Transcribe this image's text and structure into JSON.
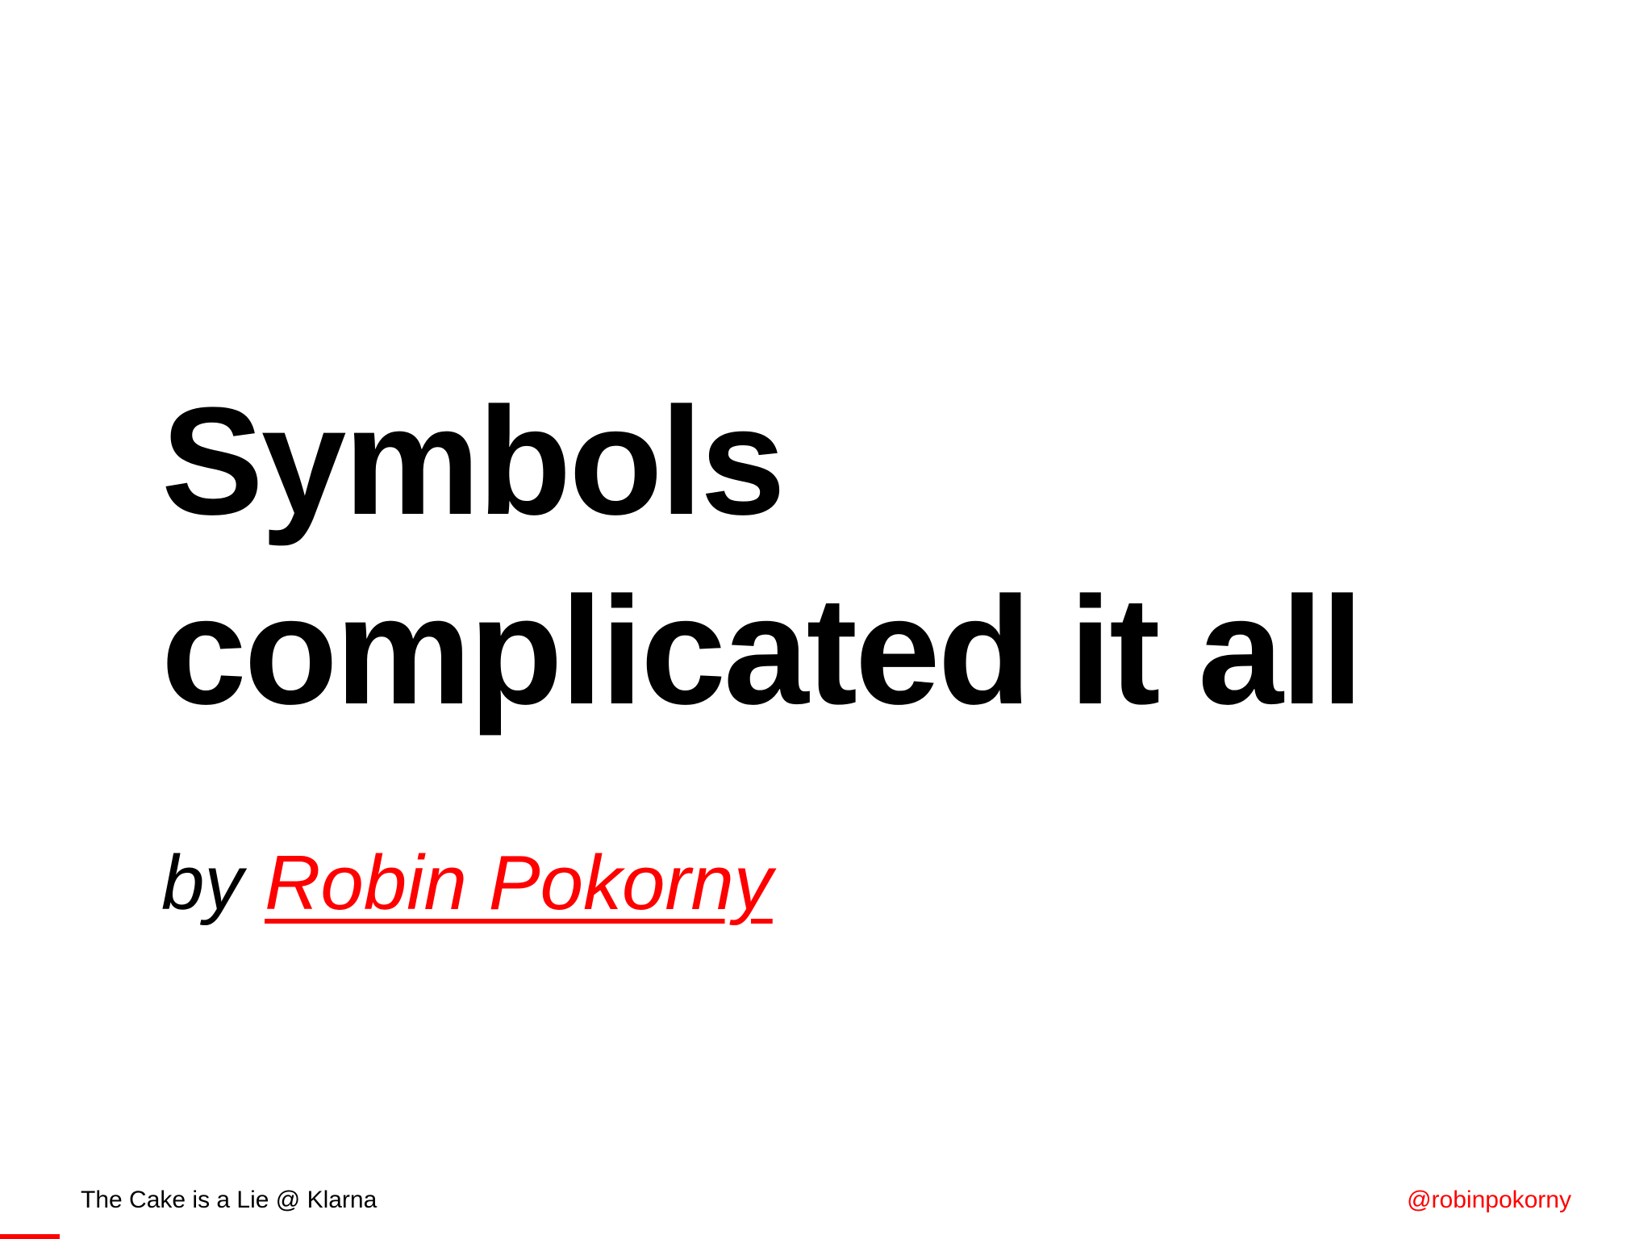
{
  "title": {
    "line1": "Symbols",
    "line2": "complicated it all"
  },
  "byline": {
    "prefix": "by",
    "author": "Robin Pokorny"
  },
  "footer": {
    "event": "The Cake is a Lie @ Klarna",
    "handle": "@robinpokorny"
  },
  "progress": {
    "fraction": 0.036
  },
  "colors": {
    "accent": "#ff0000",
    "text": "#000000",
    "background": "#ffffff"
  }
}
